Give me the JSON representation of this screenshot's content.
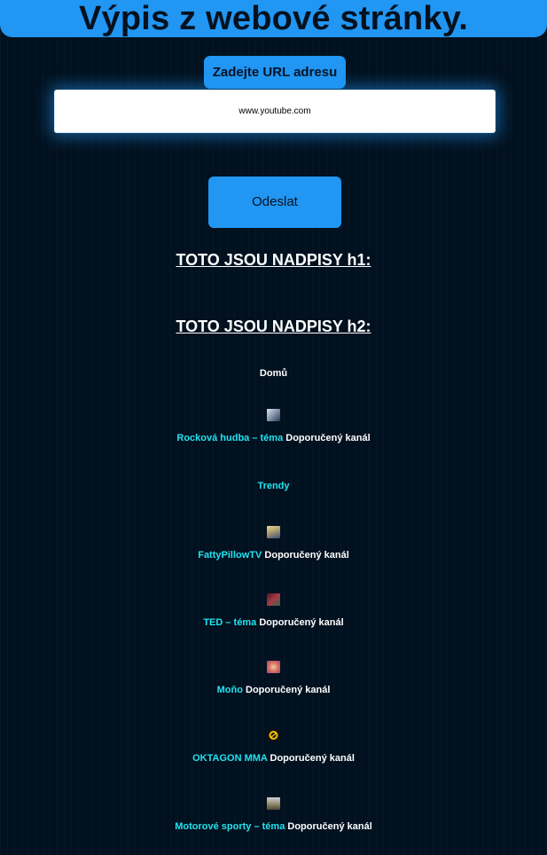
{
  "header": {
    "title": "Výpis z webové stránky."
  },
  "form": {
    "url_label": "Zadejte URL adresu",
    "url_value": "www.youtube.com",
    "submit_label": "Odeslat"
  },
  "headings": {
    "h1_title": "TOTO JSOU NADPISY h1:",
    "h2_title": "TOTO JSOU NADPISY h2:"
  },
  "h2_items": {
    "home": "Domů",
    "trending": "Trendy"
  },
  "channels": [
    {
      "name": "Rocková hudba – téma",
      "suffix": "Doporučený kanál",
      "thumb_color": "#8c9bb1",
      "thumb_icon": "rock-music-thumbnail"
    },
    {
      "name": "FattyPillowTV",
      "suffix": "Doporučený kanál",
      "thumb_color": "#b5a56e",
      "thumb_icon": "fattypillowtv-thumbnail"
    },
    {
      "name": "TED – téma",
      "suffix": "Doporučený kanál",
      "thumb_color": "#a83a46",
      "thumb_icon": "ted-thumbnail"
    },
    {
      "name": "Moňo",
      "suffix": "Doporučený kanál",
      "thumb_color": "#d4685a",
      "thumb_icon": "mono-thumbnail"
    },
    {
      "name": "OKTAGON MMA",
      "suffix": "Doporučený kanál",
      "thumb_color": "#f5c400",
      "thumb_icon": "oktagon-mma-thumbnail"
    },
    {
      "name": "Motorové sporty – téma",
      "suffix": "Doporučený kanál",
      "thumb_color": "#9a8f72",
      "thumb_icon": "motorsport-thumbnail"
    }
  ],
  "colors": {
    "accent": "#2196f3",
    "link": "#22e3f0",
    "background": "#02111f"
  }
}
